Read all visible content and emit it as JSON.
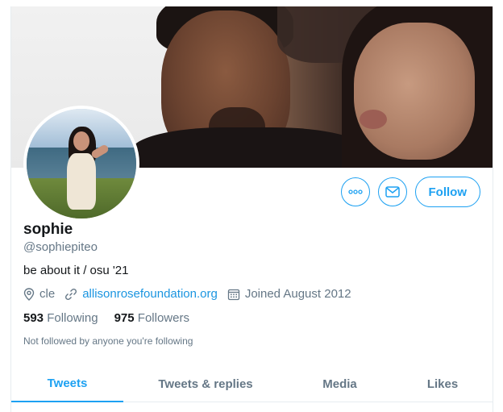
{
  "profile": {
    "name": "sophie",
    "handle": "@sophiepiteo",
    "bio": "be about it / osu '21",
    "location": "cle",
    "website": "allisonrosefoundation.org",
    "joined": "Joined August 2012",
    "following_count": "593",
    "following_label": "Following",
    "followers_count": "975",
    "followers_label": "Followers",
    "followed_by_notice": "Not followed by anyone you're following"
  },
  "actions": {
    "more_icon": "more-dots-icon",
    "message_icon": "envelope-icon",
    "follow_label": "Follow"
  },
  "tabs": [
    {
      "label": "Tweets",
      "active": true
    },
    {
      "label": "Tweets & replies",
      "active": false
    },
    {
      "label": "Media",
      "active": false
    },
    {
      "label": "Likes",
      "active": false
    }
  ],
  "colors": {
    "accent": "#1da1f2",
    "link": "#1b95e0",
    "secondary_text": "#657786",
    "primary_text": "#14171a"
  }
}
